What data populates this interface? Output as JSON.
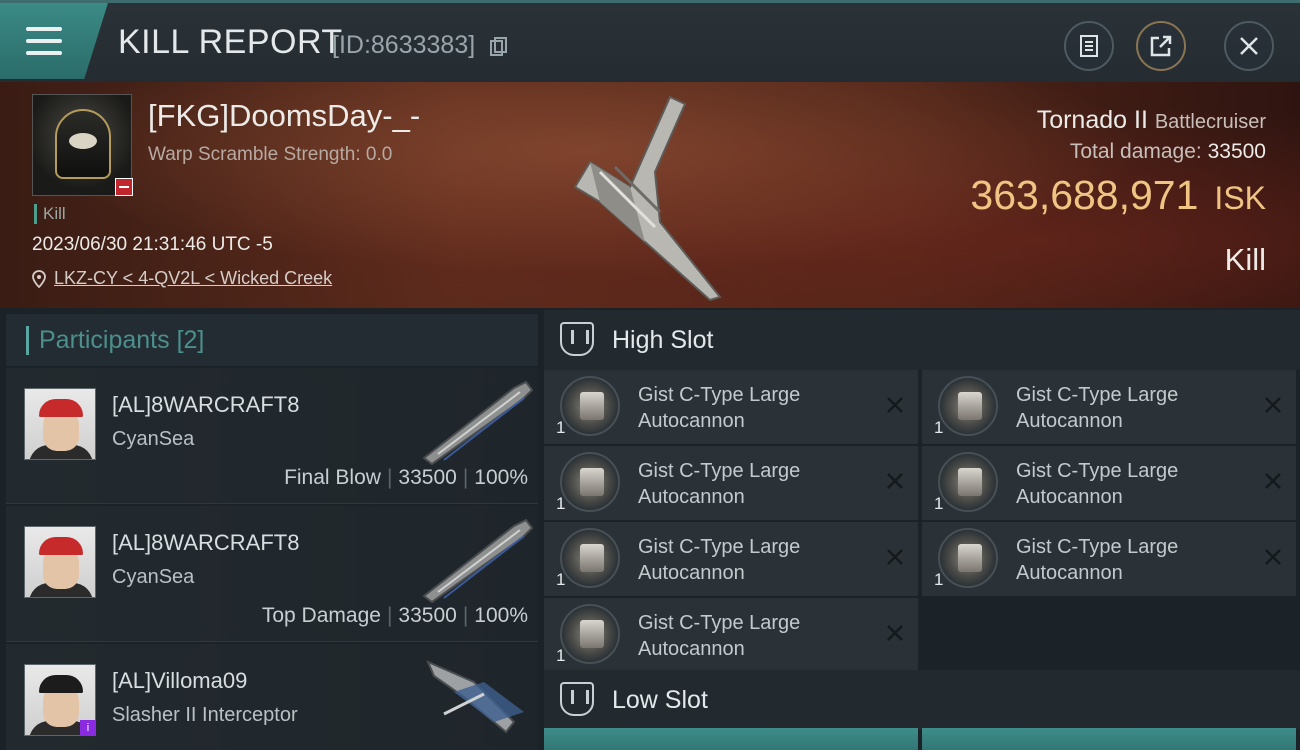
{
  "header": {
    "title": "KILL REPORT",
    "report_id": "[ID:8633383]"
  },
  "victim": {
    "name": "[FKG]DoomsDay-_-",
    "warp_scramble": "Warp Scramble Strength: 0.0",
    "tag": "Kill",
    "datetime": "2023/06/30 21:31:46 UTC -5",
    "location": "LKZ-CY < 4-QV2L < Wicked Creek",
    "ship_name": "Tornado II",
    "ship_class": "Battlecruiser",
    "total_damage_label": "Total damage:",
    "total_damage": "33500",
    "isk_value": "363,688,971",
    "isk_unit": "ISK",
    "result": "Kill"
  },
  "participants": {
    "title": "Participants",
    "count": "[2]",
    "rows": [
      {
        "name": "[AL]8WARCRAFT8",
        "corp": "CyanSea",
        "role": "Final Blow",
        "damage": "33500",
        "percent": "100%"
      },
      {
        "name": "[AL]8WARCRAFT8",
        "corp": "CyanSea",
        "role": "Top Damage",
        "damage": "33500",
        "percent": "100%"
      },
      {
        "name": "[AL]Villoma09",
        "corp": "Slasher II Interceptor"
      }
    ]
  },
  "slots": {
    "high_slot": {
      "title": "High Slot",
      "modules": [
        {
          "name": "Gist C-Type Large Autocannon",
          "qty": "1"
        },
        {
          "name": "Gist C-Type Large Autocannon",
          "qty": "1"
        },
        {
          "name": "Gist C-Type Large Autocannon",
          "qty": "1"
        },
        {
          "name": "Gist C-Type Large Autocannon",
          "qty": "1"
        },
        {
          "name": "Gist C-Type Large Autocannon",
          "qty": "1"
        },
        {
          "name": "Gist C-Type Large Autocannon",
          "qty": "1"
        },
        {
          "name": "Gist C-Type Large Autocannon",
          "qty": "1"
        }
      ]
    },
    "low_slot": {
      "title": "Low Slot"
    }
  },
  "colors": {
    "accent_teal": "#3b8a86",
    "isk_gold": "#f0c584",
    "panel_bg": "#232a2f"
  },
  "icons": [
    "menu-icon",
    "copy-icon",
    "clipboard-icon",
    "share-icon",
    "close-icon",
    "location-pin-icon",
    "high-slot-icon",
    "low-slot-icon",
    "remove-icon"
  ]
}
